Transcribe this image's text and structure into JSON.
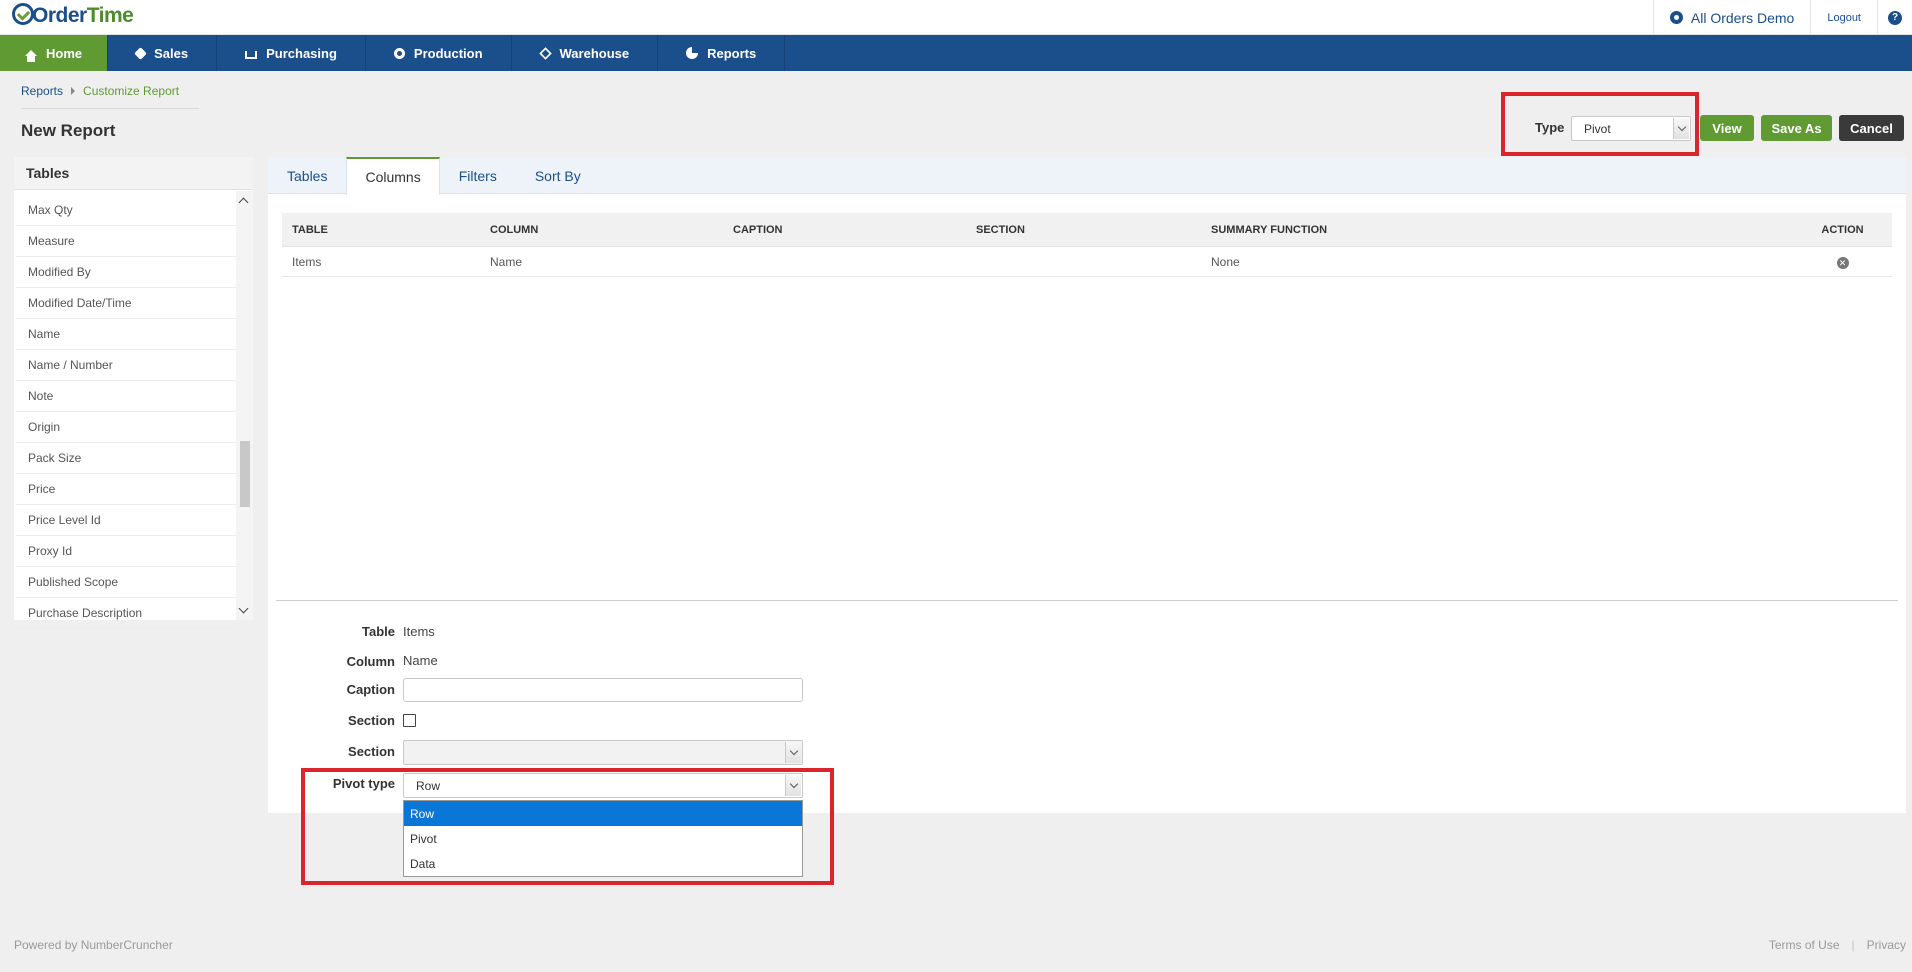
{
  "header": {
    "logo_part1": "Order",
    "logo_part2": "Time",
    "company": "All Orders Demo",
    "logout": "Logout",
    "help": "?"
  },
  "nav": {
    "items": [
      {
        "label": "Home",
        "icon": "home-icon"
      },
      {
        "label": "Sales",
        "icon": "tag-icon"
      },
      {
        "label": "Purchasing",
        "icon": "cart-icon"
      },
      {
        "label": "Production",
        "icon": "cogs-icon"
      },
      {
        "label": "Warehouse",
        "icon": "box-icon"
      },
      {
        "label": "Reports",
        "icon": "pie-chart-icon"
      }
    ],
    "active": "Home"
  },
  "breadcrumb": {
    "items": [
      "Reports",
      "Customize Report"
    ]
  },
  "page": {
    "title": "New Report"
  },
  "toolbar": {
    "type_label": "Type",
    "type_value": "Pivot",
    "view_label": "View",
    "save_as_label": "Save As",
    "cancel_label": "Cancel"
  },
  "left_panel": {
    "title": "Tables",
    "items": [
      "Max Qty",
      "Measure",
      "Modified By",
      "Modified Date/Time",
      "Name",
      "Name / Number",
      "Note",
      "Origin",
      "Pack Size",
      "Price",
      "Price Level Id",
      "Proxy Id",
      "Published Scope",
      "Purchase Description"
    ]
  },
  "tabs": [
    {
      "label": "Tables"
    },
    {
      "label": "Columns",
      "active": true
    },
    {
      "label": "Filters"
    },
    {
      "label": "Sort By"
    }
  ],
  "grid": {
    "headers": [
      "TABLE",
      "COLUMN",
      "CAPTION",
      "SECTION",
      "SUMMARY FUNCTION",
      "ACTION"
    ],
    "rows": [
      {
        "table": "Items",
        "column": "Name",
        "caption": "",
        "section": "",
        "summary": "None",
        "action_icon": "remove-icon"
      }
    ]
  },
  "form": {
    "table_label": "Table",
    "table_value": "Items",
    "column_label": "Column",
    "column_value": "Name",
    "caption_label": "Caption",
    "caption_value": "",
    "section_check_label": "Section",
    "section_check_checked": false,
    "section_select_label": "Section",
    "section_select_value": "",
    "pivot_type_label": "Pivot type",
    "pivot_type_value": "Row",
    "pivot_type_options": [
      "Row",
      "Pivot",
      "Data"
    ],
    "pivot_type_selected_option": "Row"
  },
  "footer": {
    "powered_by": "Powered by NumberCruncher",
    "terms": "Terms of Use",
    "separator": "|",
    "privacy": "Privacy"
  },
  "colors": {
    "nav_blue": "#1b4f8c",
    "brand_green": "#5f9b32",
    "highlight_red": "#d9252b",
    "selected_blue": "#0a76d8"
  }
}
